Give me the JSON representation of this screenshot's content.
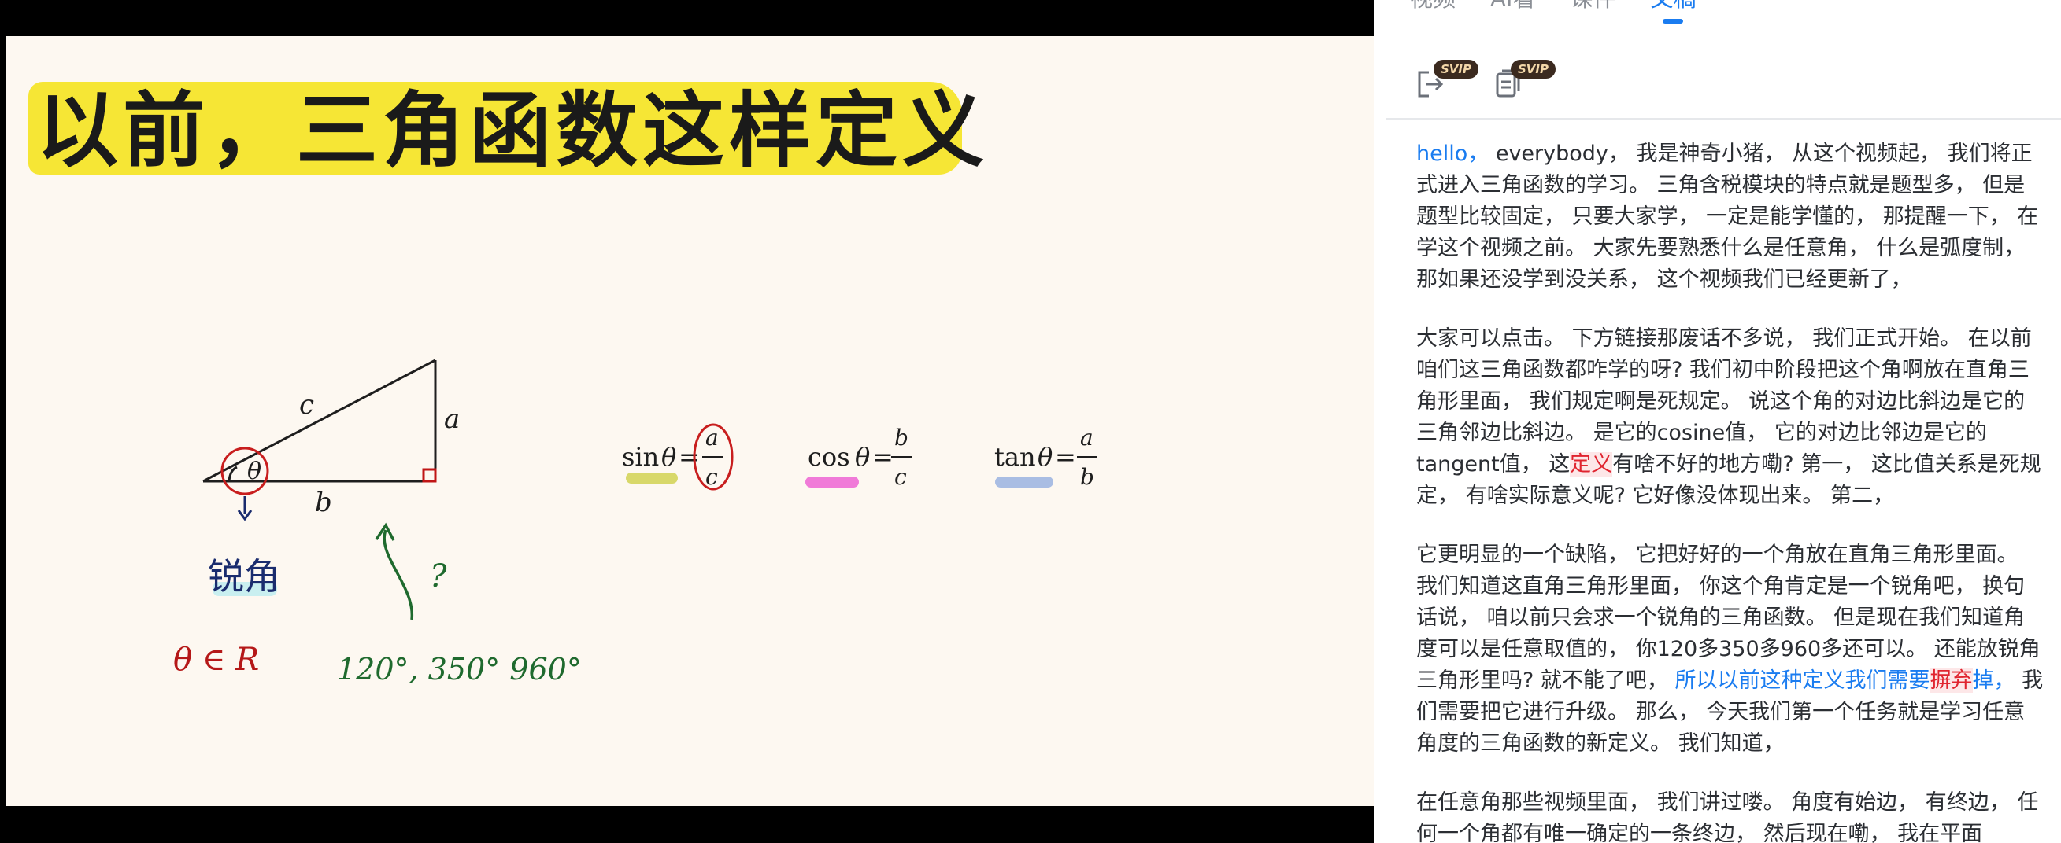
{
  "slide": {
    "title": "以前，三角函数这样定义",
    "triangle_labels": {
      "hypotenuse": "c",
      "opposite": "a",
      "adjacent": "b",
      "angle": "θ"
    },
    "acute_label": "锐角",
    "question_mark": "?",
    "formulas": [
      {
        "fn": "sin",
        "num": "a",
        "den": "c",
        "underline_color": "#d8d86a"
      },
      {
        "fn": "cos",
        "num": "b",
        "den": "c",
        "underline_color": "#f07ad8"
      },
      {
        "fn": "tan",
        "num": "a",
        "den": "b",
        "underline_color": "#a9bde3"
      }
    ],
    "theta_in_r": "θ ∈ R",
    "angles_text": "120°, 350° 960°"
  },
  "panel": {
    "tabs": [
      {
        "label": "视频",
        "active": false
      },
      {
        "label": "AI看",
        "active": false
      },
      {
        "label": "课件",
        "active": false
      },
      {
        "label": "文稿",
        "active": true
      }
    ],
    "tools": [
      {
        "icon": "export-icon",
        "badge": "SVIP"
      },
      {
        "icon": "document-icon",
        "badge": "SVIP"
      }
    ],
    "accent_color": "#1a7cf0",
    "paragraphs": [
      [
        {
          "text": "hello，",
          "style": "blue"
        },
        {
          "text": " everybody， 我是神奇小猪， 从这个视频起， 我们将正式进入三角函数的学习。 三角含税模块的特点就是题型多， 但是题型比较固定， 只要大家学， 一定是能学懂的， 那提醒一下， 在学这个视频之前。 大家先要熟悉什么是任意角， 什么是弧度制， 那如果还没学到没关系， 这个视频我们已经更新了，",
          "style": "normal"
        }
      ],
      [
        {
          "text": "大家可以点击。 下方链接那废话不多说， 我们正式开始。 在以前咱们这三角函数都咋学的呀? 我们初中阶段把这个角啊放在直角三角形里面， 我们规定啊是死规定。 说这个角的对边比斜边是它的三角邻边比斜边。 是它的cosine值， 它的对边比邻边是它的tangent值， 这",
          "style": "normal"
        },
        {
          "text": "定义",
          "style": "red"
        },
        {
          "text": "有啥不好的地方嘞? 第一， 这比值关系是死规定， 有啥实际意义呢? 它好像没体现出来。 第二，",
          "style": "normal"
        }
      ],
      [
        {
          "text": "它更明显的一个缺陷， 它把好好的一个角放在直角三角形里面。 我们知道这直角三角形里面， 你这个角肯定是一个锐角吧， 换句话说， 咱以前只会求一个锐角的三角函数。 但是现在我们知道角度可以是任意取值的， 你120多350多960多还可以。 还能放锐角三角形里吗? 就不能了吧， ",
          "style": "normal"
        },
        {
          "text": "所以以前这种定义我们需要",
          "style": "blue"
        },
        {
          "text": "摒弃",
          "style": "red"
        },
        {
          "text": "掉，",
          "style": "blue"
        },
        {
          "text": " 我们需要把它进行升级。 那么， 今天我们第一个任务就是学习任意角度的三角函数的新定义。 我们知道，",
          "style": "normal"
        }
      ],
      [
        {
          "text": "在任意角那些视频里面， 我们讲过喽。 角度有始边， 有终边， 任何一个角都有唯一确定的一条终边， 然后现在嘞， 我在平面",
          "style": "normal"
        }
      ]
    ]
  }
}
